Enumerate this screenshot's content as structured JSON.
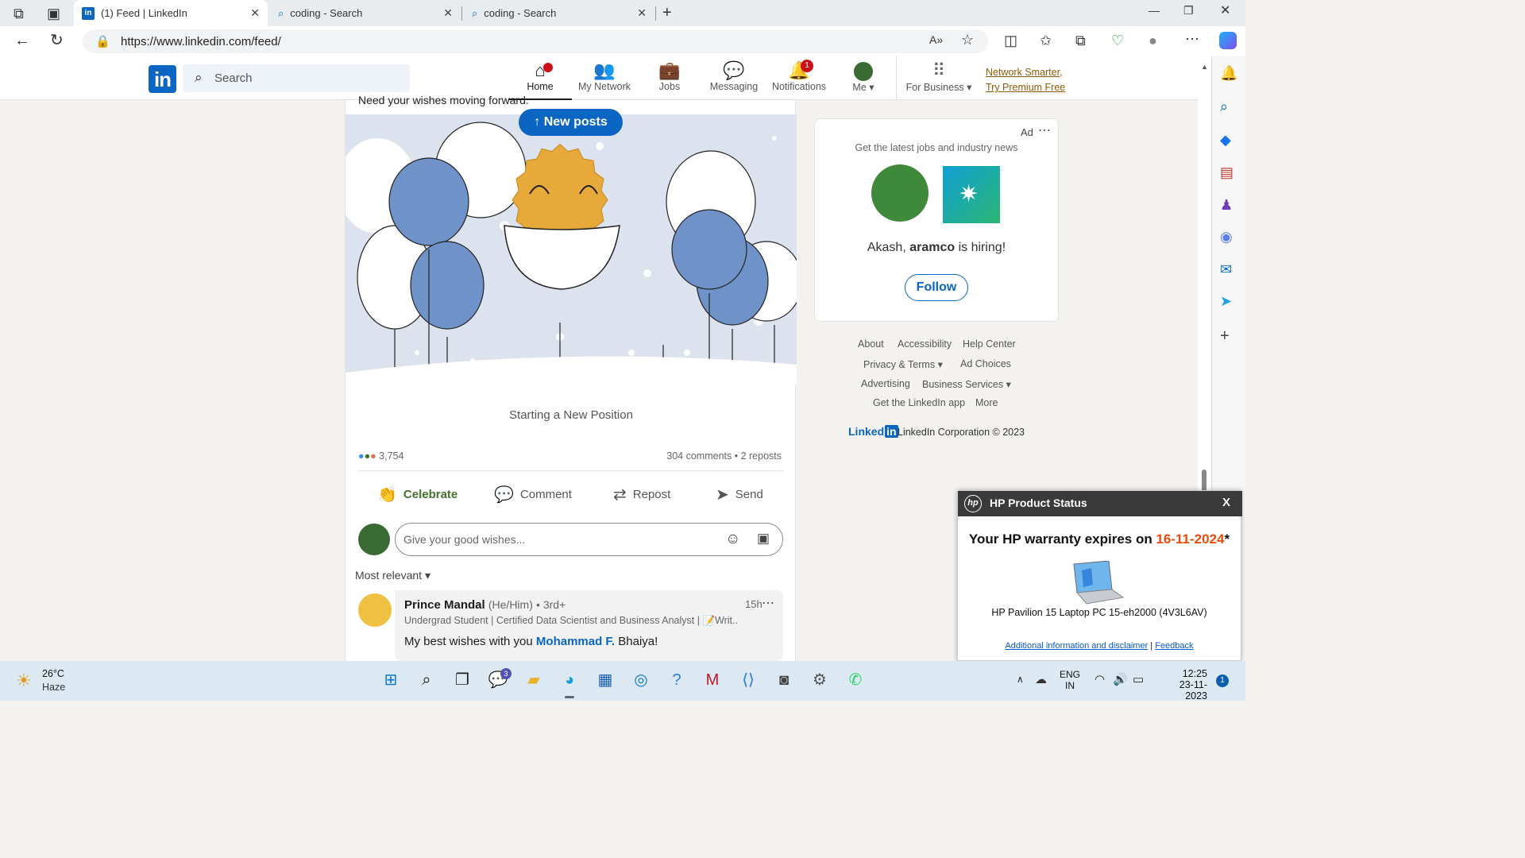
{
  "browser": {
    "tabs": [
      {
        "title": "(1) Feed | LinkedIn",
        "active": true
      },
      {
        "title": "coding - Search",
        "active": false
      },
      {
        "title": "coding - Search",
        "active": false
      }
    ],
    "url": "https://www.linkedin.com/feed/"
  },
  "nav": {
    "search_placeholder": "Search",
    "items": [
      {
        "label": "Home",
        "icon": "home-icon",
        "badge": ""
      },
      {
        "label": "My Network",
        "icon": "network-icon",
        "badge": ""
      },
      {
        "label": "Jobs",
        "icon": "briefcase-icon",
        "badge": ""
      },
      {
        "label": "Messaging",
        "icon": "chat-icon",
        "badge": ""
      },
      {
        "label": "Notifications",
        "icon": "bell-icon",
        "badge": "1"
      },
      {
        "label": "Me",
        "icon": "avatar",
        "badge": ""
      },
      {
        "label": "For Business",
        "icon": "grid-icon",
        "badge": ""
      }
    ],
    "premium_line1": "Network Smarter,",
    "premium_line2": "Try Premium Free"
  },
  "post": {
    "cut_text": "Need your wishes moving forward.",
    "new_posts": "New posts",
    "caption": "Starting a New Position",
    "reaction_count": "3,754",
    "comments": "304 comments",
    "reposts": "2 reposts",
    "actions": [
      "Celebrate",
      "Comment",
      "Repost",
      "Send"
    ],
    "comment_placeholder": "Give your good wishes...",
    "sort": "Most relevant"
  },
  "reply": {
    "name": "Prince Mandal",
    "pronouns": "(He/Him)",
    "degree": "• 3rd+",
    "headline": "Undergrad Student | Certified Data Scientist and Business Analyst | 📝Writ...",
    "time": "15h",
    "text_pre": "My best wishes with you ",
    "mention": "Mohammad F.",
    "text_post": " Bhaiya!"
  },
  "ad": {
    "label": "Ad",
    "tagline": "Get the latest jobs and industry news",
    "text_pre": "Akash, ",
    "company": "aramco",
    "text_post": " is hiring!",
    "follow": "Follow"
  },
  "footer": {
    "row1": [
      "About",
      "Accessibility",
      "Help Center"
    ],
    "row2": [
      "Privacy & Terms",
      "Ad Choices"
    ],
    "row3": [
      "Advertising",
      "Business Services"
    ],
    "row4": [
      "Get the LinkedIn app",
      "More"
    ],
    "brand": "Linked",
    "brand_in": "in",
    "copyright": "LinkedIn Corporation © 2023"
  },
  "hp": {
    "title": "HP Product Status",
    "close": "X",
    "warranty_pre": "Your HP warranty expires on ",
    "warranty_date": "16-11-2024",
    "warranty_star": "*",
    "product": "HP Pavilion 15 Laptop PC 15-eh2000 (4V3L6AV)",
    "link1": "Additional information and disclaimer",
    "link_sep": "|",
    "link2": "Feedback"
  },
  "taskbar": {
    "temp": "26°C",
    "weather": "Haze",
    "lang1": "ENG",
    "lang2": "IN",
    "time": "12:25",
    "date": "23-11-2023",
    "teams_badge": "3",
    "notif_count": "1"
  },
  "colors": {
    "linkedin_blue": "#0a66c2",
    "celebrate_green": "#44712e",
    "hp_red": "#e74c0c",
    "premium_gold": "#915907"
  }
}
